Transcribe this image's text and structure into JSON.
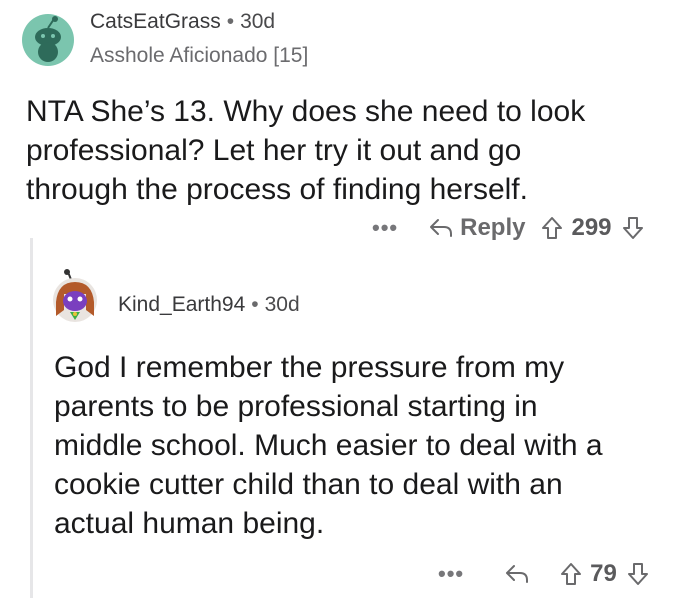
{
  "comment": {
    "username": "CatsEatGrass",
    "separator": "•",
    "age": "30d",
    "flair": "Asshole Aficionado [15]",
    "body_lines": [
      "NTA She’s 13. Why does she need to look",
      "professional? Let her try it out and go",
      "through the process of finding herself."
    ],
    "more_label": "•••",
    "reply_label": "Reply",
    "score": "299"
  },
  "reply": {
    "username": "Kind_Earth94",
    "separator": "•",
    "age": "30d",
    "body_lines": [
      "God I remember the pressure from my",
      "parents to be professional starting in",
      "middle school. Much easier to deal with a",
      "cookie cutter child than to deal with an",
      "actual human being."
    ],
    "more_label": "•••",
    "score": "79"
  },
  "colors": {
    "avatar_teal": "#7bc5ae",
    "snoo_purple": "#7a3fbf",
    "snoo_hair": "#b35a2a"
  }
}
